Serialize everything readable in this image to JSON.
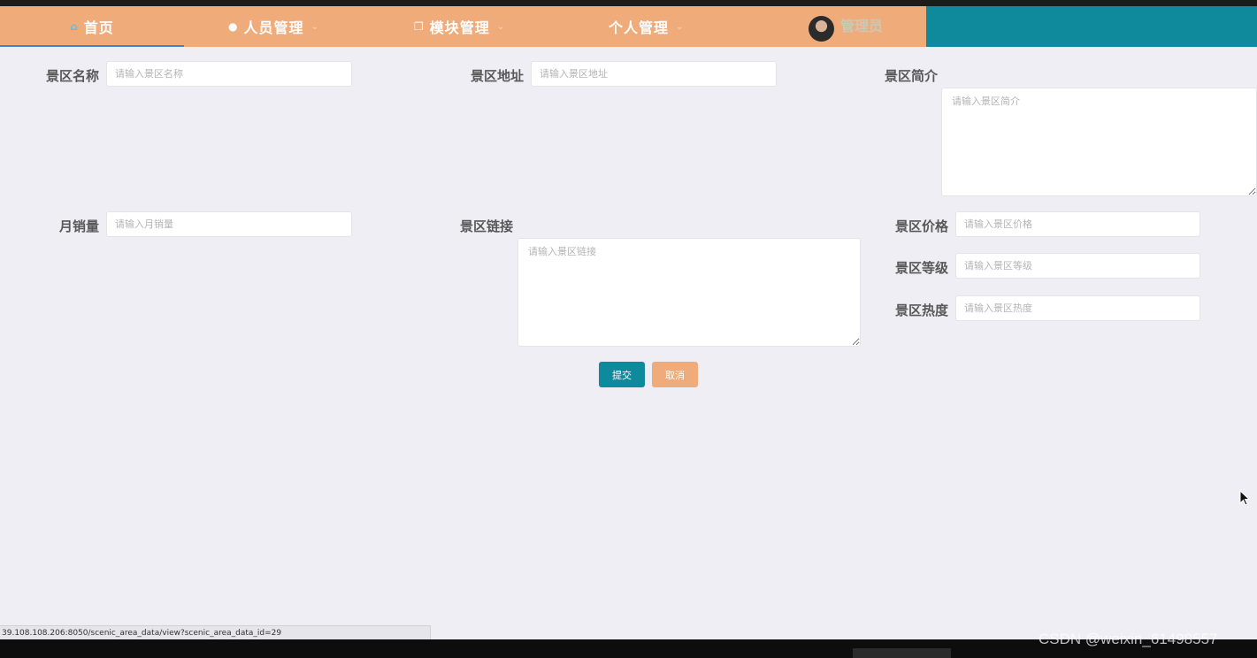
{
  "nav": {
    "home": {
      "label": "首页",
      "icon": "home-icon"
    },
    "users": {
      "label": "人员管理",
      "icon": "user-icon"
    },
    "modules": {
      "label": "模块管理",
      "icon": "copy-icon"
    },
    "personal": {
      "label": "个人管理"
    },
    "admin_name": "管理员",
    "colors": {
      "nav_bg": "#efab7a",
      "nav_right": "#0e8a9c",
      "active_underline": "#3b84d6"
    }
  },
  "form": {
    "scenic_name": {
      "label": "景区名称",
      "placeholder": "请输入景区名称",
      "value": ""
    },
    "scenic_address": {
      "label": "景区地址",
      "placeholder": "请输入景区地址",
      "value": ""
    },
    "scenic_intro": {
      "label": "景区简介",
      "placeholder": "请输入景区简介",
      "value": ""
    },
    "monthly_sales": {
      "label": "月销量",
      "placeholder": "请输入月销量",
      "value": ""
    },
    "scenic_link": {
      "label": "景区链接",
      "placeholder": "请输入景区链接",
      "value": ""
    },
    "scenic_price": {
      "label": "景区价格",
      "placeholder": "请输入景区价格",
      "value": ""
    },
    "scenic_level": {
      "label": "景区等级",
      "placeholder": "请输入景区等级",
      "value": ""
    },
    "scenic_popularity": {
      "label": "景区热度",
      "placeholder": "请输入景区热度",
      "value": ""
    },
    "submit_label": "提交",
    "cancel_label": "取消"
  },
  "status_bar": {
    "url": "39.108.108.206:8050/scenic_area_data/view?scenic_area_data_id=29"
  },
  "watermark": "CSDN @weixin_61498557"
}
